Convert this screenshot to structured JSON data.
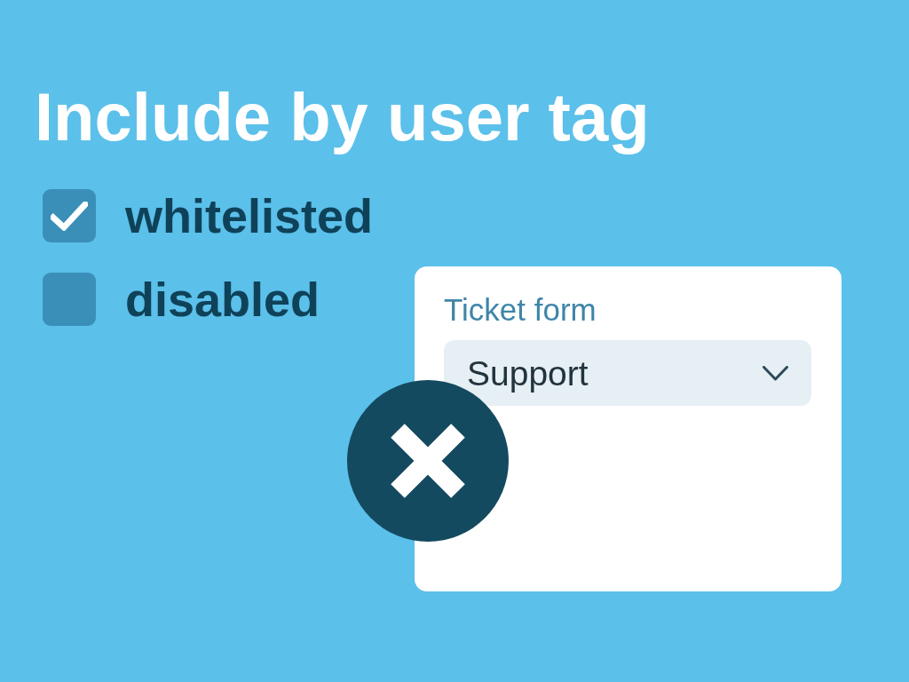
{
  "title": "Include by user tag",
  "tags": [
    {
      "label": "whitelisted",
      "checked": true
    },
    {
      "label": "disabled",
      "checked": false
    }
  ],
  "card": {
    "label": "Ticket form",
    "select": {
      "value": "Support"
    }
  }
}
